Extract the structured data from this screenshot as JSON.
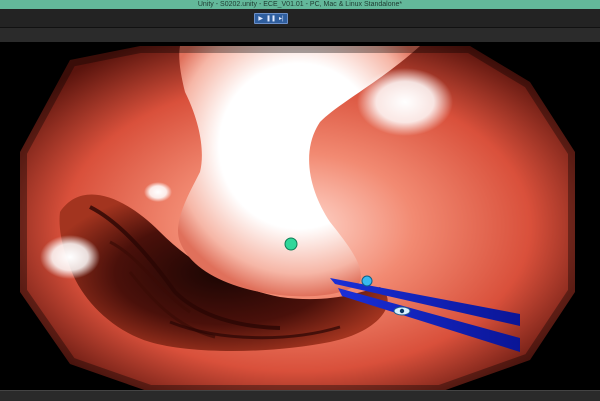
{
  "window": {
    "title": "Unity - S0202.unity - ECE_V01.01 - PC, Mac & Linux Standalone*"
  },
  "toolbar": {
    "play_icon": "play-icon",
    "pause_icon": "pause-icon",
    "step_icon": "step-icon"
  },
  "scene": {
    "icons": [
      "capsule-camera-marker-icon",
      "tool-tip-marker-icon",
      "eye-marker-icon"
    ],
    "colors": {
      "tissue": "#e8644f",
      "tissue_dark": "#6b1a12",
      "highlight": "#ffffff",
      "instrument": "#1f3df0",
      "marker_green": "#2fd79a",
      "marker_blue": "#38b8f0"
    }
  }
}
